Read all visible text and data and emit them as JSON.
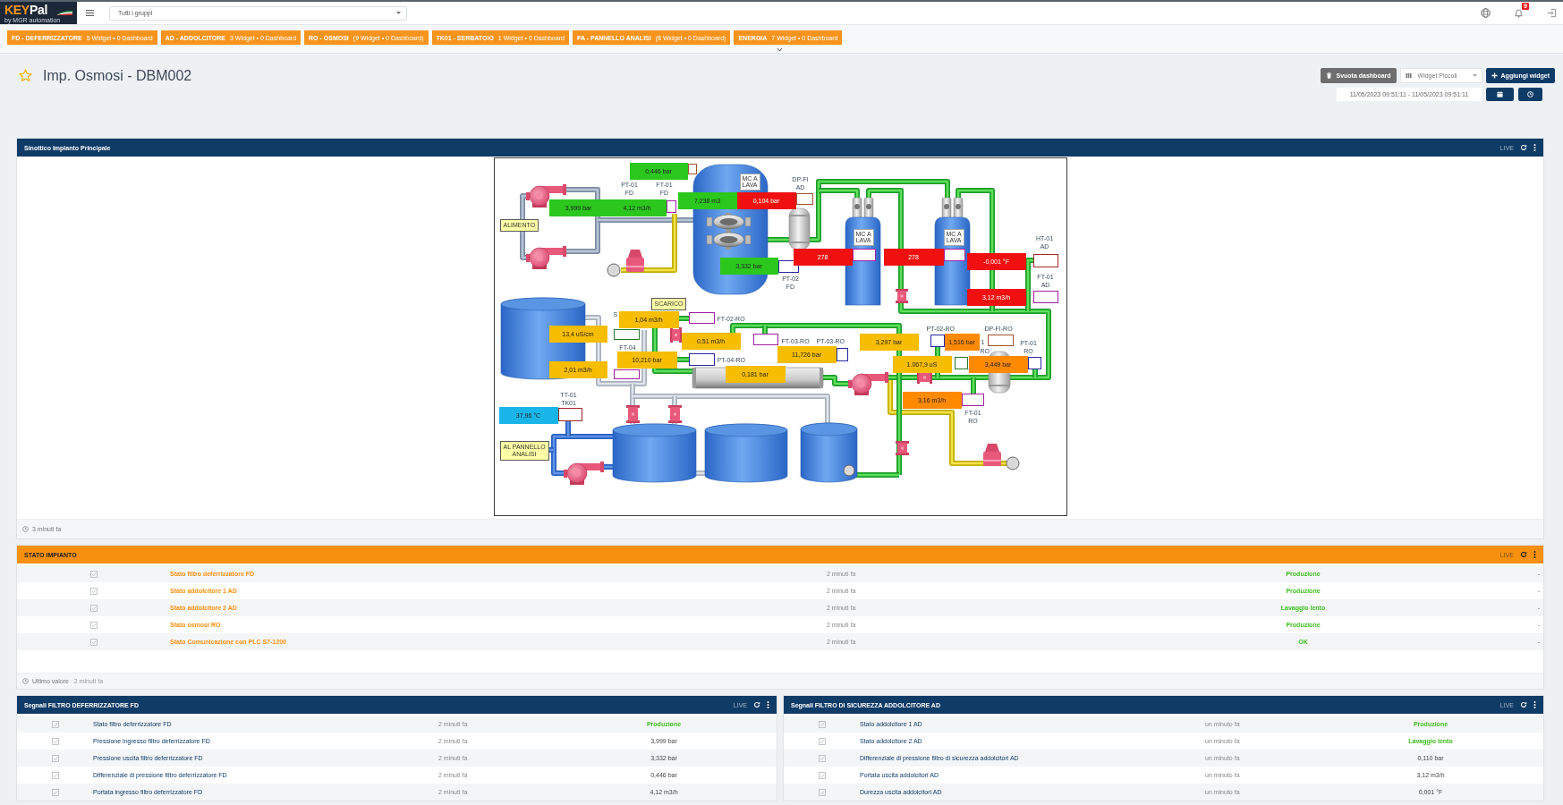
{
  "topbar": {
    "logo": {
      "parts": [
        "KEY",
        "Pal"
      ],
      "tagline": "by MGR automation"
    },
    "group_select": {
      "value": "Tutti i gruppi"
    },
    "alarm_badge": "9"
  },
  "group_tabs": [
    {
      "label": "FD - DEFERRIZZATORE",
      "info": "5 Widget • 0 Dashboard"
    },
    {
      "label": "AD - ADDOLCITORE",
      "info": "3 Widget • 0 Dashboard"
    },
    {
      "label": "RO - OSMOSI",
      "info": "(9 Widget • 0 Dashboard)"
    },
    {
      "label": "TK01 - SERBATOIO",
      "info": "1 Widget • 0 Dashboard"
    },
    {
      "label": "PA - PANNELLO ANALISI",
      "info": "(8 Widget • 0 Dashboard)"
    },
    {
      "label": "ENERGIA",
      "info": "7 Widget • 0 Dashboard"
    }
  ],
  "dashboard": {
    "title": "Imp. Osmosi - DBM002",
    "favorite": false,
    "clear_button": "Svuota dashboard",
    "size_select": {
      "value": "Widget Piccoli"
    },
    "add_button": "Aggiungi widget",
    "date_range": {
      "value": "11/05/2023 09:51:11 - 11/05/2023 09:51:11"
    }
  },
  "widget_rows": [
    [
      {
        "kind": "synoptic",
        "title": "Sinottico Impianto Principale",
        "color": "#0f3b67",
        "live": "LIVE",
        "diagram": {
          "readings": [
            {
              "value": "0,446 bar",
              "color": "#2bc71d"
            },
            {
              "value": "3,999 bar",
              "color": "#2bc71d"
            },
            {
              "value": "4,12 m3/h",
              "color": "#2bc71d"
            },
            {
              "value": "7,238 m3",
              "color": "#2bc71d"
            },
            {
              "value": "0,104 bar",
              "color": "#f01010"
            },
            {
              "value": "3,332 bar",
              "color": "#2bc71d"
            },
            {
              "value": "278",
              "color": "#f01010"
            },
            {
              "value": "278",
              "color": "#f01010"
            },
            {
              "value": "-0,001 °F",
              "color": "#f01010"
            },
            {
              "value": "3,12 m3/h",
              "color": "#f01010"
            },
            {
              "value": "13,4 uS/cm",
              "color": "#f7bd00"
            },
            {
              "value": "2,01 m3/h",
              "color": "#f7bd00"
            },
            {
              "value": "1,04 m3/h",
              "color": "#f7bd00"
            },
            {
              "value": "0,51 m3/h",
              "color": "#f7bd00"
            },
            {
              "value": "10,210 bar",
              "color": "#f7bd00"
            },
            {
              "value": "11,726 bar",
              "color": "#f7bd00"
            },
            {
              "value": "3,297 bar",
              "color": "#f7bd00"
            },
            {
              "value": "1,516 bar",
              "color": "#ff8a00"
            },
            {
              "value": "1.067,9 uS",
              "color": "#f7bd00"
            },
            {
              "value": "3,449 bar",
              "color": "#ff8a00"
            },
            {
              "value": "0,181 bar",
              "color": "#f7bd00"
            },
            {
              "value": "3,16 m3/h",
              "color": "#ff8a00"
            },
            {
              "value": "37,96 °C",
              "color": "#18b6e8"
            }
          ],
          "frames": [
            {
              "color": "#a0522d"
            },
            {
              "color": "#a020a0"
            },
            {
              "color": "#a0522d"
            },
            {
              "color": "#2828a0"
            },
            {
              "color": "#a020a0"
            },
            {
              "color": "#a020a0"
            },
            {
              "color": "#a02828"
            },
            {
              "color": "#a020a0"
            },
            {
              "color": "#a020a0"
            },
            {
              "color": "#287828"
            },
            {
              "color": "#a020a0"
            },
            {
              "color": "#2828a0"
            },
            {
              "color": "#a020a0"
            },
            {
              "color": "#2828a0"
            },
            {
              "color": "#2828a0"
            },
            {
              "color": "#a0522d"
            },
            {
              "color": "#287828"
            },
            {
              "color": "#2828a0"
            },
            {
              "color": "#a020a0"
            },
            {
              "color": "#a02828"
            }
          ],
          "signs": [
            {
              "lines": [
                "ALIMENTO"
              ]
            },
            {
              "lines": [
                "SCARICO"
              ]
            },
            {
              "lines": [
                "AL PANNELLO",
                "ANALISI"
              ]
            }
          ],
          "equipment_labels": [
            {
              "lines": [
                "MC A",
                "LAVA"
              ]
            },
            {
              "lines": [
                "MC A",
                "LAVA"
              ]
            },
            {
              "lines": [
                "MC A",
                "LAVA"
              ]
            }
          ],
          "tags": [
            {
              "lines": [
                "PT-01",
                "FD"
              ]
            },
            {
              "lines": [
                "FT-01",
                "FD"
              ]
            },
            {
              "lines": [
                "DP-FI",
                "AD"
              ]
            },
            {
              "lines": [
                "PT-02",
                "FD"
              ]
            },
            {
              "lines": [
                "HT-01",
                "AD"
              ]
            },
            {
              "lines": [
                "FT-01",
                "AD"
              ]
            },
            {
              "lines": [
                "S"
              ]
            },
            {
              "lines": [
                "FT-02-RO"
              ]
            },
            {
              "lines": [
                "FT-04"
              ]
            },
            {
              "lines": [
                "PT-04-RO"
              ]
            },
            {
              "lines": [
                "FT-03-RO"
              ]
            },
            {
              "lines": [
                "PT-03-RO"
              ]
            },
            {
              "lines": [
                "PT-02-RO"
              ]
            },
            {
              "lines": [
                "1"
              ]
            },
            {
              "lines": [
                "RO"
              ]
            },
            {
              "lines": [
                "DP-FI-RO"
              ]
            },
            {
              "lines": [
                "PT-01",
                "RO"
              ]
            },
            {
              "lines": [
                "FT-01",
                "RO"
              ]
            },
            {
              "lines": [
                "TT-01",
                "TK01"
              ]
            }
          ]
        },
        "footer": {
          "updated": "3 minuti fa"
        }
      }
    ],
    [
      {
        "kind": "status_table",
        "title": "STATO IMPIANTO",
        "color": "#f7900f",
        "live": "LIVE",
        "rows": [
          {
            "label": "Stato filtro deferrizzatore FD",
            "time": "2 minuti fa",
            "value": "Produzione",
            "kind": "status",
            "trend": "-"
          },
          {
            "label": "Stato addolcitore 1 AD",
            "time": "2 minuti fa",
            "value": "Produzione",
            "kind": "status",
            "trend": "-"
          },
          {
            "label": "Stato addolcitore 2 AD",
            "time": "2 minuti fa",
            "value": "Lavaggio lento",
            "kind": "status",
            "trend": "-"
          },
          {
            "label": "Stato osmosi RO",
            "time": "2 minuti fa",
            "value": "Produzione",
            "kind": "status",
            "trend": "-"
          },
          {
            "label": "Stato Comunicazione con PLC S7-1200",
            "time": "2 minuti fa",
            "value": "OK",
            "kind": "status",
            "trend": "-"
          }
        ],
        "footer": {
          "label": "Ultimo valore",
          "updated": "2 minuti fa"
        }
      }
    ],
    [
      {
        "kind": "signal_table",
        "title": "Segnali FILTRO DEFERRIZZATORE FD",
        "color": "#0f3b67",
        "live": "LIVE",
        "rows": [
          {
            "label": "Stato filtro deferrizzatore FD",
            "time": "2 minuti fa",
            "value": "Produzione",
            "kind": "status"
          },
          {
            "label": "Pressione ingresso filtro deferrizzatore FD",
            "time": "2 minuti fa",
            "value": "3,999 bar",
            "kind": "measure"
          },
          {
            "label": "Pressione uscita filtro deferrizzatore FD",
            "time": "2 minuti fa",
            "value": "3,332 bar",
            "kind": "measure"
          },
          {
            "label": "Differenziale di pressione filtro deferrizzatore FD",
            "time": "2 minuti fa",
            "value": "0,446 bar",
            "kind": "measure"
          },
          {
            "label": "Portata ingresso filtro deferrizzatore FD",
            "time": "2 minuti fa",
            "value": "4,12 m3/h",
            "kind": "measure"
          }
        ]
      },
      {
        "kind": "signal_table",
        "title": "Segnali FILTRO DI SICUREZZA ADDOLCITORE AD",
        "color": "#0f3b67",
        "live": "LIVE",
        "rows": [
          {
            "label": "Stato addolcitore 1 AD",
            "time": "un minuto fa",
            "value": "Produzione",
            "kind": "status"
          },
          {
            "label": "Stato addolcitore 2 AD",
            "time": "un minuto fa",
            "value": "Lavaggio lento",
            "kind": "status"
          },
          {
            "label": "Differenziale di pressione filtro di sicurezza addolcitori AD",
            "time": "un minuto fa",
            "value": "0,110 bar",
            "kind": "measure"
          },
          {
            "label": "Portata uscita addolcitori AD",
            "time": "un minuto fa",
            "value": "3,12 m3/h",
            "kind": "measure"
          },
          {
            "label": "Durezza uscita addolcitori AD",
            "time": "un minuto fa",
            "value": "0,001 °F",
            "kind": "measure"
          }
        ]
      }
    ]
  ]
}
